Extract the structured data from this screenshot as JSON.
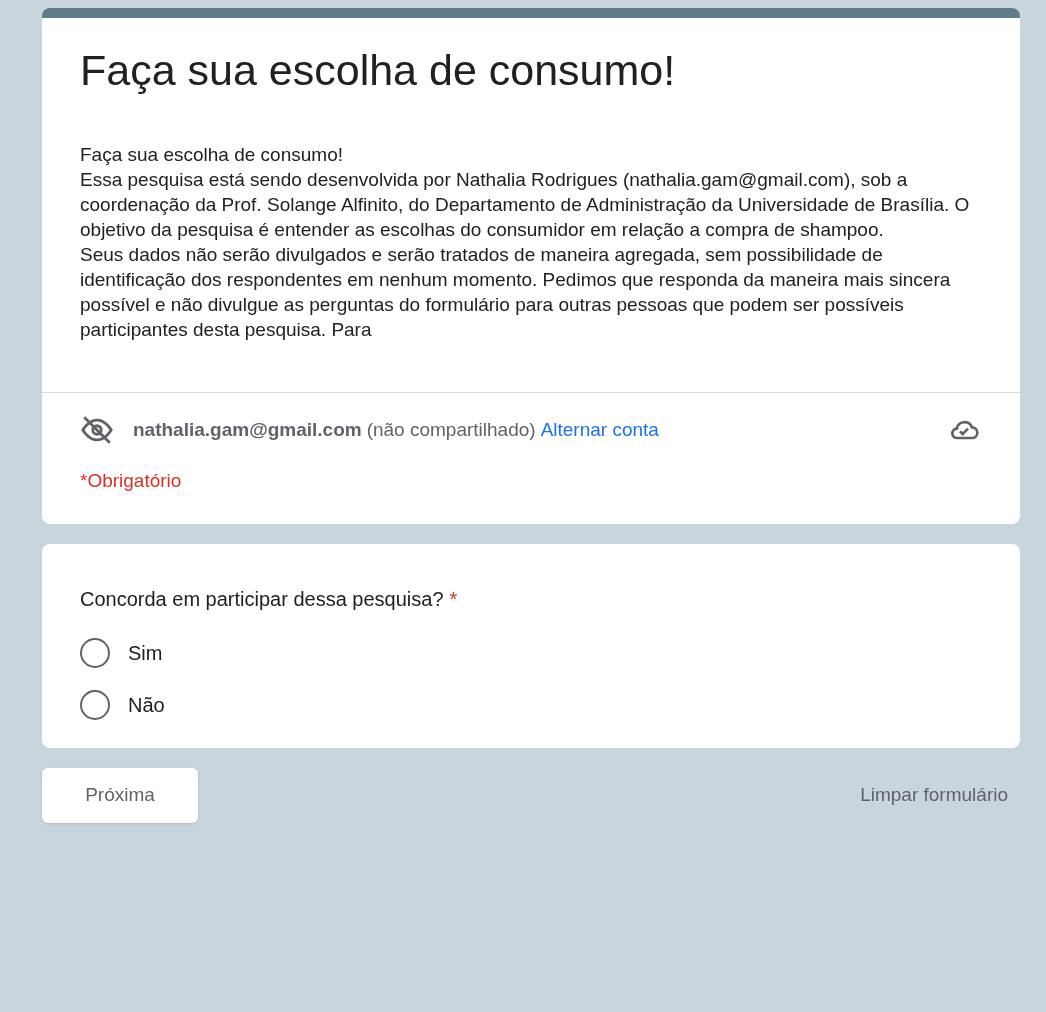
{
  "form": {
    "title": "Faça sua escolha de consumo!",
    "description": [
      "Faça sua escolha de consumo!",
      "Essa pesquisa está sendo desenvolvida por Nathalia Rodrigues (nathalia.gam@gmail.com), sob a coordenação da Prof. Solange Alfinito, do Departamento de Administração da Universidade de Brasília. O objetivo da pesquisa é entender as escolhas do consumidor em relação a compra de shampoo.",
      "Seus dados não serão divulgados e serão tratados de maneira agregada, sem possibilidade de identificação dos respondentes em nenhum momento. Pedimos que responda da maneira mais sincera possível e não divulgue as perguntas do formulário para outras pessoas que podem ser possíveis participantes desta pesquisa. Para"
    ],
    "account": {
      "email": "nathalia.gam@gmail.com",
      "note": "(não compartilhado)",
      "switch_link": "Alternar conta"
    },
    "required_note": "*Obrigatório"
  },
  "question": {
    "text": "Concorda em participar dessa pesquisa?",
    "required_mark": "*",
    "options": [
      {
        "label": "Sim",
        "selected": false
      },
      {
        "label": "Não",
        "selected": false
      }
    ]
  },
  "footer": {
    "next_button": "Próxima",
    "clear_link": "Limpar formulário"
  }
}
